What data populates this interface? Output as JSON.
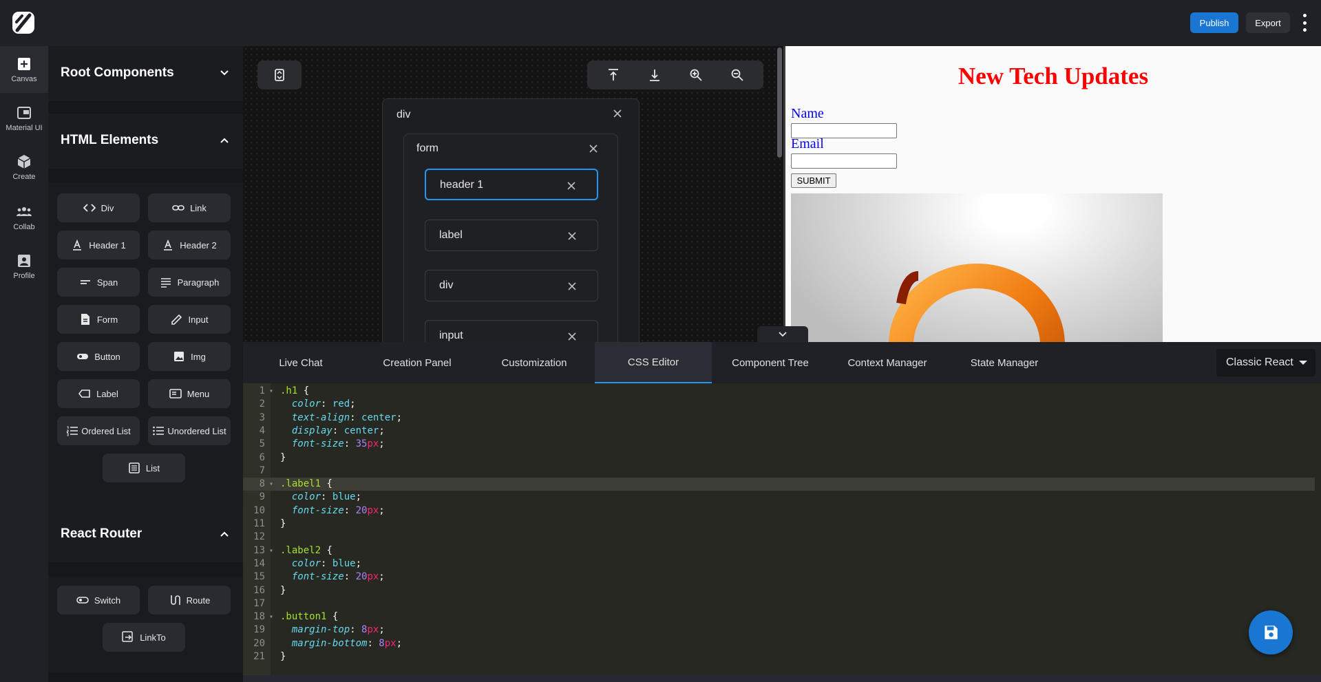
{
  "topbar": {
    "logo_icon": "slash-logo-icon",
    "publish_label": "Publish",
    "export_label": "Export",
    "menu_icon": "kebab-menu-icon"
  },
  "rail": [
    {
      "label": "Canvas",
      "icon": "add-box-icon",
      "active": true
    },
    {
      "label": "Material UI",
      "icon": "web-icon",
      "active": false
    },
    {
      "label": "Create",
      "icon": "cube-icon",
      "active": false
    },
    {
      "label": "Collab",
      "icon": "group-icon",
      "active": false
    },
    {
      "label": "Profile",
      "icon": "account-box-icon",
      "active": false
    }
  ],
  "panel": {
    "root_components": {
      "title": "Root Components",
      "expanded": false
    },
    "html_elements": {
      "title": "HTML Elements",
      "expanded": true,
      "items": [
        {
          "label": "Div",
          "icon": "code-icon"
        },
        {
          "label": "Link",
          "icon": "link-icon"
        },
        {
          "label": "Header 1",
          "icon": "text-format-icon"
        },
        {
          "label": "Header 2",
          "icon": "text-format-icon"
        },
        {
          "label": "Span",
          "icon": "short-text-icon"
        },
        {
          "label": "Paragraph",
          "icon": "notes-icon"
        },
        {
          "label": "Form",
          "icon": "description-icon"
        },
        {
          "label": "Input",
          "icon": "edit-icon"
        },
        {
          "label": "Button",
          "icon": "toggle-button-icon"
        },
        {
          "label": "Img",
          "icon": "image-icon"
        },
        {
          "label": "Label",
          "icon": "label-icon"
        },
        {
          "label": "Menu",
          "icon": "menu-box-icon"
        },
        {
          "label": "Ordered List",
          "icon": "ordered-list-icon"
        },
        {
          "label": "Unordered List",
          "icon": "unordered-list-icon"
        },
        {
          "label": "List",
          "icon": "list-box-icon"
        }
      ]
    },
    "react_router": {
      "title": "React Router",
      "expanded": true,
      "items": [
        {
          "label": "Switch",
          "icon": "switch-icon"
        },
        {
          "label": "Route",
          "icon": "route-icon"
        },
        {
          "label": "LinkTo",
          "icon": "link-to-icon"
        }
      ]
    }
  },
  "canvas": {
    "toolbar_icons": [
      "align-top-icon",
      "align-bottom-icon",
      "zoom-in-icon",
      "zoom-out-icon"
    ],
    "tree": {
      "root": "div",
      "child": "form",
      "leaves": [
        {
          "label": "header 1",
          "selected": true
        },
        {
          "label": "label",
          "selected": false
        },
        {
          "label": "div",
          "selected": false
        },
        {
          "label": "input",
          "selected": false
        }
      ]
    }
  },
  "preview": {
    "title": "New Tech Updates",
    "name_label": "Name",
    "email_label": "Email",
    "submit_label": "SUBMIT"
  },
  "tabs": [
    {
      "label": "Live Chat",
      "active": false
    },
    {
      "label": "Creation Panel",
      "active": false
    },
    {
      "label": "Customization",
      "active": false
    },
    {
      "label": "CSS Editor",
      "active": true
    },
    {
      "label": "Component Tree",
      "active": false
    },
    {
      "label": "Context Manager",
      "active": false
    },
    {
      "label": "State Manager",
      "active": false
    }
  ],
  "mode_select": {
    "value": "Classic React"
  },
  "css_editor": {
    "highlighted_line": 8,
    "lines": [
      ".h1 {",
      "  color: red;",
      "  text-align: center;",
      "  display: center;",
      "  font-size: 35px;",
      "}",
      "",
      ".label1 {",
      "  color: blue;",
      "  font-size: 20px;",
      "}",
      "",
      ".label2 {",
      "  color: blue;",
      "  font-size: 20px;",
      "}",
      "",
      ".button1 {",
      "  margin-top: 8px;",
      "  margin-bottom: 8px;",
      "}"
    ]
  },
  "colors": {
    "accent": "#1976d2",
    "selected_border": "#2196f3",
    "preview_title": "#ff0000",
    "preview_label": "#0000ff"
  },
  "save_fab_icon": "save-icon"
}
